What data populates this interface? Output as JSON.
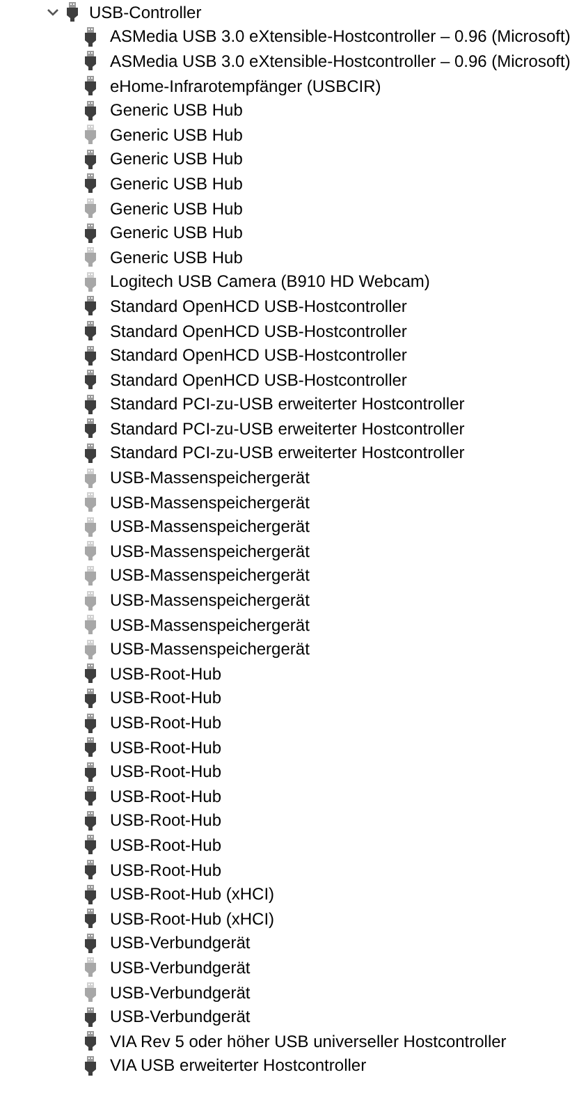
{
  "tree": {
    "label": "USB-Controller",
    "expanded": true,
    "children": [
      {
        "label": "ASMedia USB 3.0 eXtensible-Hostcontroller – 0.96 (Microsoft)",
        "hidden": false
      },
      {
        "label": "ASMedia USB 3.0 eXtensible-Hostcontroller – 0.96 (Microsoft)",
        "hidden": false
      },
      {
        "label": "eHome-Infrarotempfänger (USBCIR)",
        "hidden": false
      },
      {
        "label": "Generic USB Hub",
        "hidden": false
      },
      {
        "label": "Generic USB Hub",
        "hidden": true
      },
      {
        "label": "Generic USB Hub",
        "hidden": false
      },
      {
        "label": "Generic USB Hub",
        "hidden": false
      },
      {
        "label": "Generic USB Hub",
        "hidden": true
      },
      {
        "label": "Generic USB Hub",
        "hidden": false
      },
      {
        "label": "Generic USB Hub",
        "hidden": true
      },
      {
        "label": "Logitech USB Camera (B910 HD Webcam)",
        "hidden": true
      },
      {
        "label": "Standard OpenHCD USB-Hostcontroller",
        "hidden": false
      },
      {
        "label": "Standard OpenHCD USB-Hostcontroller",
        "hidden": false
      },
      {
        "label": "Standard OpenHCD USB-Hostcontroller",
        "hidden": false
      },
      {
        "label": "Standard OpenHCD USB-Hostcontroller",
        "hidden": false
      },
      {
        "label": "Standard PCI-zu-USB erweiterter Hostcontroller",
        "hidden": false
      },
      {
        "label": "Standard PCI-zu-USB erweiterter Hostcontroller",
        "hidden": false
      },
      {
        "label": "Standard PCI-zu-USB erweiterter Hostcontroller",
        "hidden": false
      },
      {
        "label": "USB-Massenspeichergerät",
        "hidden": true
      },
      {
        "label": "USB-Massenspeichergerät",
        "hidden": true
      },
      {
        "label": "USB-Massenspeichergerät",
        "hidden": true
      },
      {
        "label": "USB-Massenspeichergerät",
        "hidden": true
      },
      {
        "label": "USB-Massenspeichergerät",
        "hidden": true
      },
      {
        "label": "USB-Massenspeichergerät",
        "hidden": true
      },
      {
        "label": "USB-Massenspeichergerät",
        "hidden": true
      },
      {
        "label": "USB-Massenspeichergerät",
        "hidden": true
      },
      {
        "label": "USB-Root-Hub",
        "hidden": false
      },
      {
        "label": "USB-Root-Hub",
        "hidden": false
      },
      {
        "label": "USB-Root-Hub",
        "hidden": false
      },
      {
        "label": "USB-Root-Hub",
        "hidden": false
      },
      {
        "label": "USB-Root-Hub",
        "hidden": false
      },
      {
        "label": "USB-Root-Hub",
        "hidden": false
      },
      {
        "label": "USB-Root-Hub",
        "hidden": false
      },
      {
        "label": "USB-Root-Hub",
        "hidden": false
      },
      {
        "label": "USB-Root-Hub",
        "hidden": false
      },
      {
        "label": "USB-Root-Hub (xHCI)",
        "hidden": false
      },
      {
        "label": "USB-Root-Hub (xHCI)",
        "hidden": false
      },
      {
        "label": "USB-Verbundgerät",
        "hidden": false
      },
      {
        "label": "USB-Verbundgerät",
        "hidden": true
      },
      {
        "label": "USB-Verbundgerät",
        "hidden": true
      },
      {
        "label": "USB-Verbundgerät",
        "hidden": false
      },
      {
        "label": "VIA Rev 5 oder höher USB universeller Hostcontroller",
        "hidden": false
      },
      {
        "label": "VIA USB erweiterter Hostcontroller",
        "hidden": false
      }
    ]
  }
}
